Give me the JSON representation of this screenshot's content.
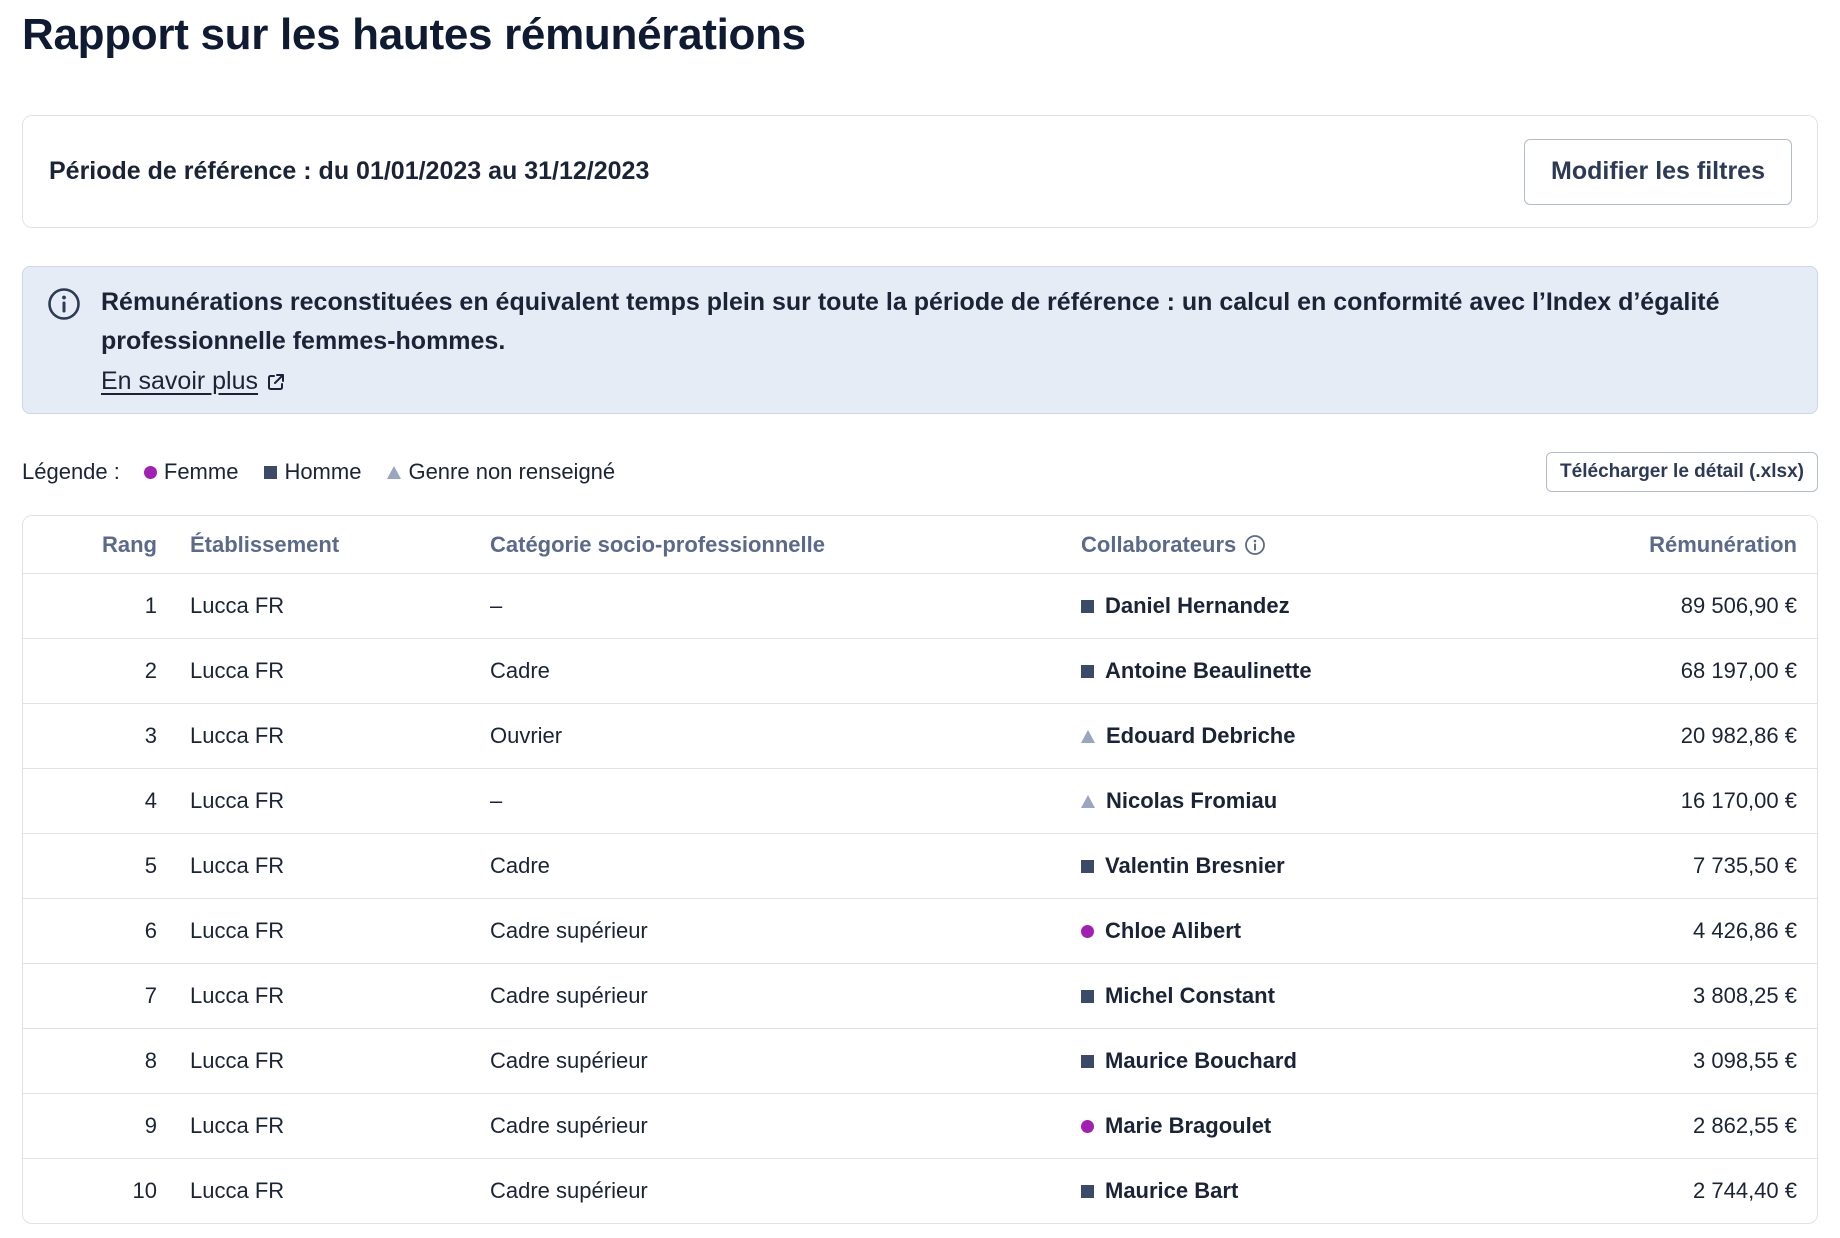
{
  "page": {
    "title": "Rapport sur les hautes rémunérations"
  },
  "filters": {
    "period_text": "Période de référence : du 01/01/2023 au 31/12/2023",
    "modify_button": "Modifier les filtres"
  },
  "info": {
    "icon": "info-circle-icon",
    "text": "Rémunérations reconstituées en équivalent temps plein sur toute la période de référence : un calcul en conformité avec l’Index d’égalité professionnelle femmes-hommes.",
    "link_label": "En savoir plus",
    "link_icon": "external-link-icon"
  },
  "legend": {
    "label": "Légende :",
    "items": [
      {
        "label": "Femme",
        "shape": "circle",
        "color": "#a020b0"
      },
      {
        "label": "Homme",
        "shape": "square",
        "color": "#3b4a66"
      },
      {
        "label": "Genre non renseigné",
        "shape": "triangle",
        "color": "#98a6c0"
      }
    ]
  },
  "download_button": "Télécharger le détail  (.xlsx)",
  "table": {
    "headers": {
      "rank": "Rang",
      "establishment": "Établissement",
      "category": "Catégorie socio-professionnelle",
      "employees": "Collaborateurs",
      "employees_icon": "info-circle-icon",
      "salary": "Rémunération"
    },
    "rows": [
      {
        "rank": "1",
        "establishment": "Lucca FR",
        "category": "–",
        "gender": "square",
        "name": "Daniel Hernandez",
        "salary": "89 506,90 €"
      },
      {
        "rank": "2",
        "establishment": "Lucca FR",
        "category": "Cadre",
        "gender": "square",
        "name": "Antoine Beaulinette",
        "salary": "68 197,00 €"
      },
      {
        "rank": "3",
        "establishment": "Lucca FR",
        "category": "Ouvrier",
        "gender": "triangle",
        "name": "Edouard Debriche",
        "salary": "20 982,86 €"
      },
      {
        "rank": "4",
        "establishment": "Lucca FR",
        "category": "–",
        "gender": "triangle",
        "name": "Nicolas Fromiau",
        "salary": "16 170,00 €"
      },
      {
        "rank": "5",
        "establishment": "Lucca FR",
        "category": "Cadre",
        "gender": "square",
        "name": "Valentin Bresnier",
        "salary": "7 735,50 €"
      },
      {
        "rank": "6",
        "establishment": "Lucca FR",
        "category": "Cadre supérieur",
        "gender": "circle",
        "name": "Chloe Alibert",
        "salary": "4 426,86 €"
      },
      {
        "rank": "7",
        "establishment": "Lucca FR",
        "category": "Cadre supérieur",
        "gender": "square",
        "name": "Michel Constant",
        "salary": "3 808,25 €"
      },
      {
        "rank": "8",
        "establishment": "Lucca FR",
        "category": "Cadre supérieur",
        "gender": "square",
        "name": "Maurice Bouchard",
        "salary": "3 098,55 €"
      },
      {
        "rank": "9",
        "establishment": "Lucca FR",
        "category": "Cadre supérieur",
        "gender": "circle",
        "name": "Marie Bragoulet",
        "salary": "2 862,55 €"
      },
      {
        "rank": "10",
        "establishment": "Lucca FR",
        "category": "Cadre supérieur",
        "gender": "square",
        "name": "Maurice Bart",
        "salary": "2 744,40 €"
      }
    ]
  },
  "colors": {
    "femme": "#a020b0",
    "homme": "#3b4a66",
    "non_renseigne": "#98a6c0",
    "callout_bg": "#e6ecf6",
    "title": "#0f1a33"
  }
}
